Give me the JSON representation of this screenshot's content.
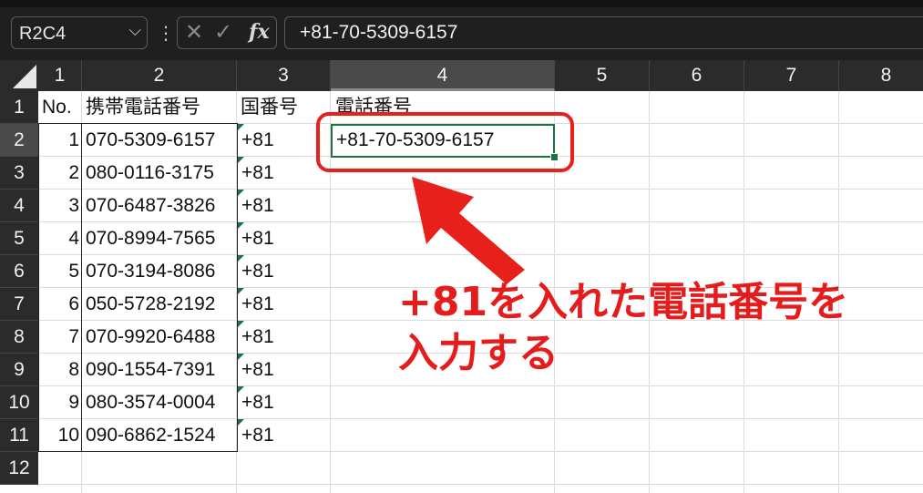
{
  "formula_bar": {
    "name_box": "R2C4",
    "formula": "+81-70-5309-6157",
    "icons": [
      "cancel-icon",
      "enter-icon",
      "function-icon"
    ],
    "fx_label": "fx"
  },
  "sheet": {
    "columns": [
      "1",
      "2",
      "3",
      "4",
      "5",
      "6",
      "7",
      "8"
    ],
    "rows": [
      "1",
      "2",
      "3",
      "4",
      "5",
      "6",
      "7",
      "8",
      "9",
      "10",
      "11",
      "12"
    ],
    "selected_column": "4",
    "selected_row": "2",
    "headers": {
      "no": "No.",
      "mobile": "携帯電話番号",
      "country": "国番号",
      "phone": "電話番号"
    },
    "records": [
      {
        "no": "1",
        "mobile": "070-5309-6157",
        "country": "+81",
        "phone": "+81-70-5309-6157"
      },
      {
        "no": "2",
        "mobile": "080-0116-3175",
        "country": "+81",
        "phone": ""
      },
      {
        "no": "3",
        "mobile": "070-6487-3826",
        "country": "+81",
        "phone": ""
      },
      {
        "no": "4",
        "mobile": "070-8994-7565",
        "country": "+81",
        "phone": ""
      },
      {
        "no": "5",
        "mobile": "070-3194-8086",
        "country": "+81",
        "phone": ""
      },
      {
        "no": "6",
        "mobile": "050-5728-2192",
        "country": "+81",
        "phone": ""
      },
      {
        "no": "7",
        "mobile": "070-9920-6488",
        "country": "+81",
        "phone": ""
      },
      {
        "no": "8",
        "mobile": "090-1554-7391",
        "country": "+81",
        "phone": ""
      },
      {
        "no": "9",
        "mobile": "080-3574-0004",
        "country": "+81",
        "phone": ""
      },
      {
        "no": "10",
        "mobile": "090-6862-1524",
        "country": "+81",
        "phone": ""
      }
    ]
  },
  "annotation": {
    "line1": "+81を入れた電話番号を",
    "line2": "入力する",
    "color": "#e51c1c"
  },
  "colors": {
    "selection": "#1e7145",
    "callout": "#e8201c"
  }
}
